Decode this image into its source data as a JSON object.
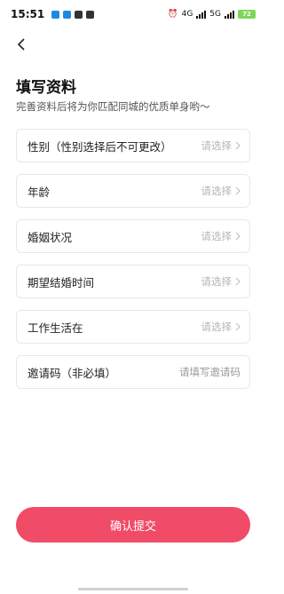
{
  "status_bar": {
    "time": "15:51",
    "network_labels": [
      "4G",
      "5G"
    ],
    "battery": "72",
    "colors": {
      "battery": "#7bd65a"
    }
  },
  "header": {
    "back_icon": "chevron-left-icon",
    "title": "填写资料",
    "subtitle": "完善资料后将为你匹配同城的优质单身哟～"
  },
  "form": {
    "fields": [
      {
        "label": "性别（性别选择后不可更改）",
        "placeholder": "请选择"
      },
      {
        "label": "年龄",
        "placeholder": "请选择"
      },
      {
        "label": "婚姻状况",
        "placeholder": "请选择"
      },
      {
        "label": "期望结婚时间",
        "placeholder": "请选择"
      },
      {
        "label": "工作生活在",
        "placeholder": "请选择"
      }
    ],
    "invite": {
      "label": "邀请码（非必填）",
      "placeholder": "请填写邀请码",
      "value": ""
    }
  },
  "submit": {
    "label": "确认提交",
    "color": "#f04b67"
  }
}
